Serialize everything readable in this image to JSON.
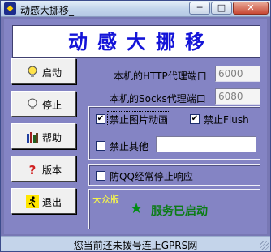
{
  "window": {
    "title": "动感大挪移_",
    "app_icon": "app-logo-icon",
    "controls": {
      "minimize": "─",
      "maximize": "□",
      "close": "✕"
    }
  },
  "banner": {
    "text": "动感大挪移"
  },
  "side_buttons": [
    {
      "label": "启动",
      "icon": "lightbulb-icon"
    },
    {
      "label": "停止",
      "icon": "lightbulb-off-icon"
    },
    {
      "label": "帮助",
      "icon": "books-icon"
    },
    {
      "label": "版本",
      "icon": "question-icon"
    },
    {
      "label": "退出",
      "icon": "exit-runner-icon"
    }
  ],
  "proxy": {
    "http_label": "本机的HTTP代理端口",
    "http_port": "6000",
    "socks_label": "本机的Socks代理端口",
    "socks_port": "6080"
  },
  "options": {
    "block_gif": {
      "label": "禁止图片动画",
      "checked": true,
      "mark": "✔"
    },
    "block_flash": {
      "label": "禁止Flush",
      "checked": true,
      "mark": "✔"
    },
    "block_other": {
      "label": "禁止其他",
      "checked": false,
      "value": ""
    },
    "anti_qq": {
      "label": "防QQ经常停止响应",
      "checked": false
    }
  },
  "status_panel": {
    "edition": "大众版",
    "star": "★",
    "service_status": "服务已启动"
  },
  "statusbar": {
    "text": "您当前还未拨号连上GPRS网"
  },
  "colors": {
    "banner_text": "#1414d8",
    "service_green": "#0a7c14",
    "edition_yellow": "#ffff40",
    "client_bg": "#8484c4"
  }
}
